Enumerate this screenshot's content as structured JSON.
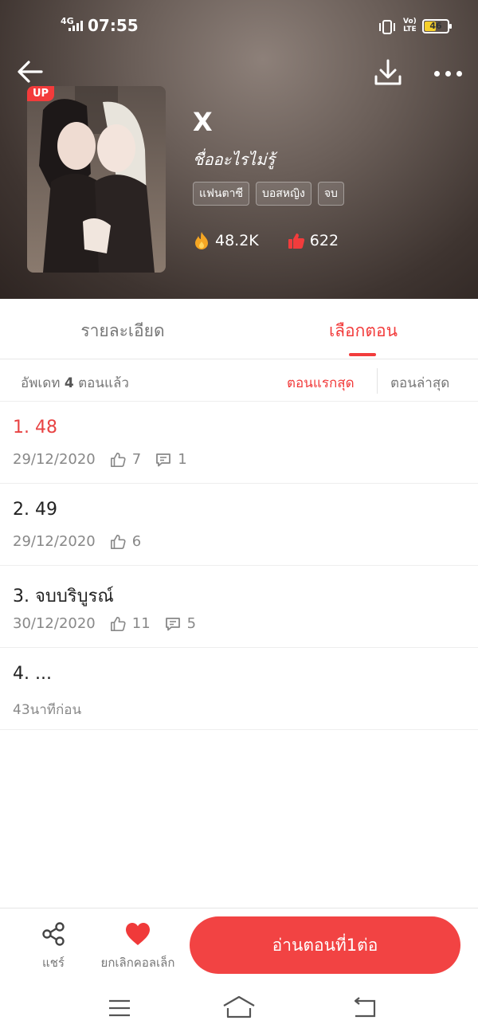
{
  "status_bar": {
    "network": "4G",
    "time": "07:55",
    "volte": "Vo\nLTE",
    "battery": "46"
  },
  "novel": {
    "badge": "UP",
    "title": "X",
    "subtitle": "ชื่ออะไรไม่รู้",
    "tags": [
      "แฟนตาซี",
      "บอสหญิง",
      "จบ"
    ],
    "views": "48.2K",
    "likes": "622"
  },
  "tabs": {
    "detail": "รายละเอียด",
    "episodes": "เลือกตอน"
  },
  "sort_bar": {
    "update_prefix": "อัพเดท ",
    "update_count": "4",
    "update_suffix": " ตอนแล้ว",
    "first": "ตอนแรกสุด",
    "latest": "ตอนล่าสุด"
  },
  "episodes": [
    {
      "title": "1. 48",
      "date": "29/12/2020",
      "likes": "7",
      "comments": "1"
    },
    {
      "title": "2. 49",
      "date": "29/12/2020",
      "likes": "6"
    },
    {
      "title": "3. จบบริบูรณ์",
      "date": "30/12/2020",
      "likes": "11",
      "comments": "5"
    },
    {
      "title": "4. ...",
      "date": "43นาทีก่อน"
    }
  ],
  "bottom": {
    "share_label": "แชร์",
    "favorite_label": "ยกเลิกคอลเล็ก",
    "read_label": "อ่านตอนที่1ต่อ"
  },
  "colors": {
    "accent": "#f24343",
    "header_bg": "#4a3f3a"
  },
  "icons": [
    "back-arrow-icon",
    "download-icon",
    "more-icon",
    "fire-icon",
    "thumbs-up-icon",
    "comment-icon",
    "share-icon",
    "heart-icon",
    "menu-icon",
    "home-icon",
    "back-icon"
  ]
}
